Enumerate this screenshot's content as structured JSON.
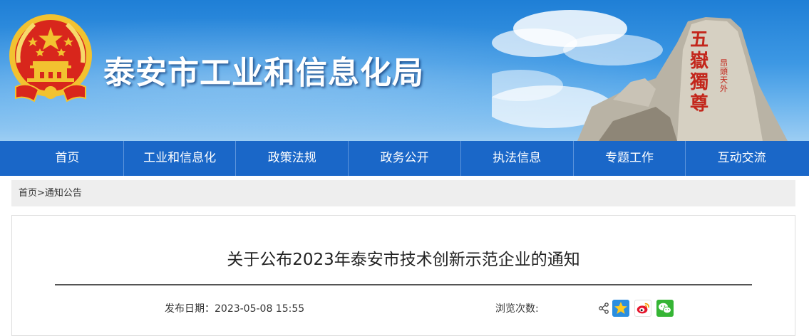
{
  "header": {
    "site_title": "泰安市工业和信息化局",
    "scenery_inscription": "五嶽獨尊",
    "scenery_side_text": "昂頭天外"
  },
  "nav": {
    "items": [
      {
        "label": "首页"
      },
      {
        "label": "工业和信息化"
      },
      {
        "label": "政策法规"
      },
      {
        "label": "政务公开"
      },
      {
        "label": "执法信息"
      },
      {
        "label": "专题工作"
      },
      {
        "label": "互动交流"
      }
    ]
  },
  "breadcrumb": {
    "home": "首页",
    "separator": ">",
    "current": "通知公告"
  },
  "article": {
    "title": "关于公布2023年泰安市技术创新示范企业的通知",
    "publish_date_label": "发布日期：",
    "publish_date": "2023-05-08 15:55",
    "views_label": "浏览次数:"
  },
  "share": {
    "icons": [
      "share-icon",
      "qzone-icon",
      "weibo-icon",
      "wechat-icon"
    ]
  },
  "colors": {
    "nav_bg": "#1a67c8",
    "banner_top": "#1f7fd6",
    "emblem_red": "#d8261c",
    "emblem_gold": "#f2c230"
  }
}
